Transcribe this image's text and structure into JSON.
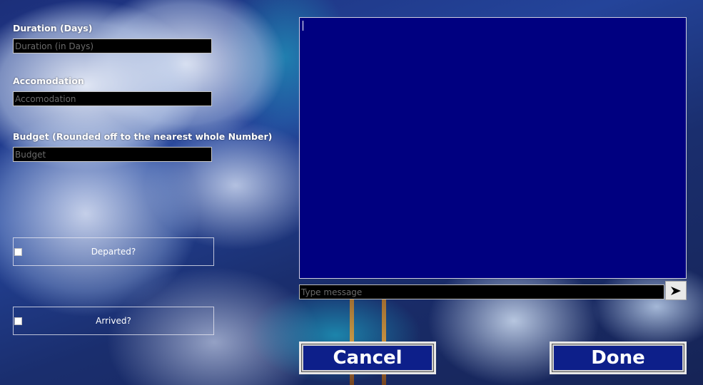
{
  "form": {
    "duration": {
      "label": "Duration (Days)",
      "placeholder": "Duration (in Days)",
      "value": ""
    },
    "accommodation": {
      "label": "Accomodation",
      "placeholder": "Accomodation",
      "value": ""
    },
    "budget": {
      "label": "Budget (Rounded off to the nearest whole Number)",
      "placeholder": "Budget",
      "value": ""
    },
    "departed": {
      "label": "Departed?",
      "checked": false
    },
    "arrived": {
      "label": "Arrived?",
      "checked": false
    }
  },
  "chat": {
    "messages": [],
    "input_placeholder": "Type message",
    "send_icon": "arrow-right-icon"
  },
  "actions": {
    "cancel_label": "Cancel",
    "done_label": "Done"
  }
}
